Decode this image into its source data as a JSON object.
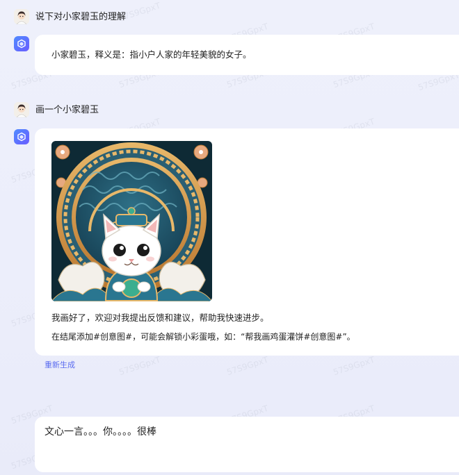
{
  "conversation": [
    {
      "user_message": "说下对小家碧玉的理解",
      "bot_reply": "小家碧玉，释义是：指小户人家的年轻美貌的女子。"
    },
    {
      "user_message": "画一个小家碧玉",
      "bot_image": "generated-cat-illustration",
      "bot_reply_line1": "我画好了，欢迎对我提出反馈和建议，帮助我快速进步。",
      "bot_reply_line2": "在结尾添加#创意图#，可能会解锁小彩蛋哦，如：“帮我画鸡蛋灌饼#创意图#”。"
    }
  ],
  "regenerate_label": "重新生成",
  "input": {
    "value": "文心一言。。。你。。。。很棒"
  },
  "watermark_text": "57S9GpxT",
  "colors": {
    "background": "#eceefb",
    "bubble": "#ffffff",
    "accent": "#5b6cf0",
    "bot_avatar": "#5b74ff"
  },
  "icons": {
    "user_avatar": "user-avatar-icon",
    "bot_avatar": "bot-avatar-icon"
  }
}
